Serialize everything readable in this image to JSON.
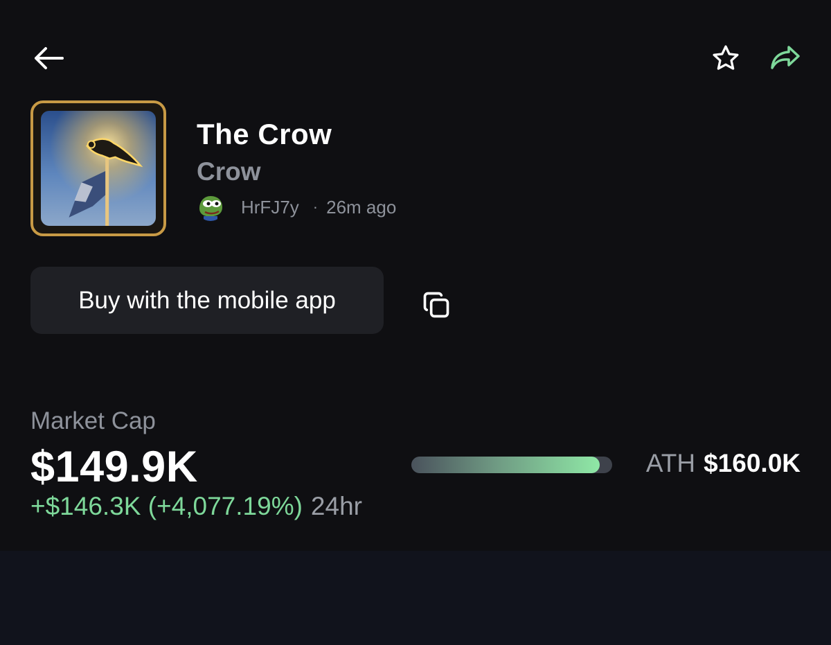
{
  "header": {
    "back_icon": "arrow-left-icon",
    "favorite_icon": "star-outline-icon",
    "share_icon": "share-forward-icon"
  },
  "token": {
    "name": "The Crow",
    "ticker": "Crow",
    "creator": "HrFJ7y",
    "separator": "·",
    "created_ago": "26m ago"
  },
  "actions": {
    "buy_label": "Buy with the mobile app",
    "copy_icon": "copy-icon"
  },
  "market": {
    "label": "Market Cap",
    "value": "$149.9K",
    "change": "+$146.3K (+4,077.19%)",
    "period": "24hr",
    "ath_label": "ATH",
    "ath_value": "$160.0K",
    "ath_progress": 0.937
  },
  "colors": {
    "background": "#0f0f12",
    "accent_green": "#7ed89a",
    "muted_text": "#8e929b",
    "avatar_border": "#c89a45",
    "button_bg": "#1f2025"
  }
}
